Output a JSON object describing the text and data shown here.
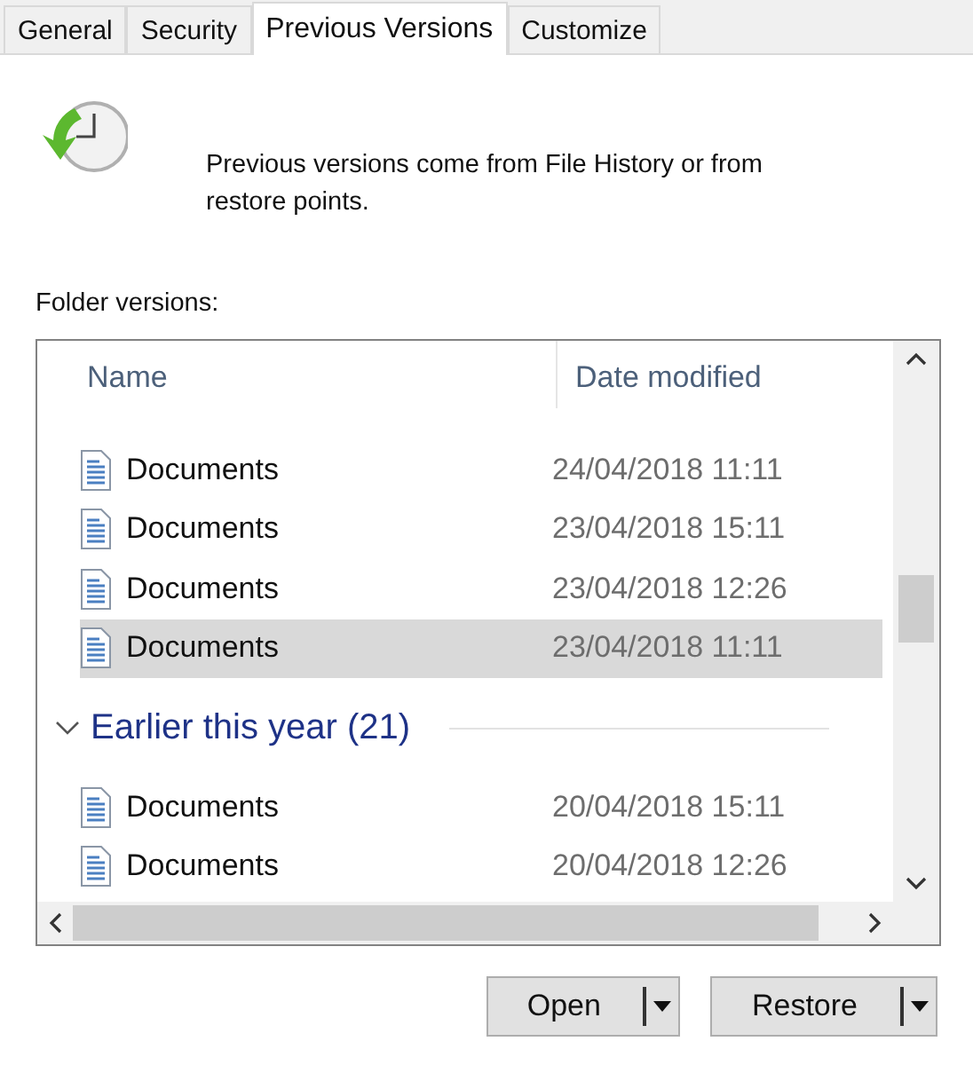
{
  "tabs": [
    {
      "label": "General",
      "selected": false
    },
    {
      "label": "Security",
      "selected": false
    },
    {
      "label": "Previous Versions",
      "selected": true
    },
    {
      "label": "Customize",
      "selected": false
    }
  ],
  "info": "Previous versions come from File History or from restore points.",
  "list_label": "Folder versions:",
  "columns": [
    "Name",
    "Date modified"
  ],
  "items": [
    {
      "kind": "file",
      "name": "Documents",
      "date": "24/04/2018 11:11",
      "selected": false
    },
    {
      "kind": "file",
      "name": "Documents",
      "date": "23/04/2018 15:11",
      "selected": false
    },
    {
      "kind": "file",
      "name": "Documents",
      "date": "23/04/2018 12:26",
      "selected": false
    },
    {
      "kind": "file",
      "name": "Documents",
      "date": "23/04/2018 11:11",
      "selected": true
    },
    {
      "kind": "group",
      "name": "Earlier this year (21)",
      "expanded": true
    },
    {
      "kind": "file",
      "name": "Documents",
      "date": "20/04/2018 15:11",
      "selected": false
    },
    {
      "kind": "file",
      "name": "Documents",
      "date": "20/04/2018 12:26",
      "selected": false
    }
  ],
  "buttons": [
    "Open",
    "Restore"
  ]
}
